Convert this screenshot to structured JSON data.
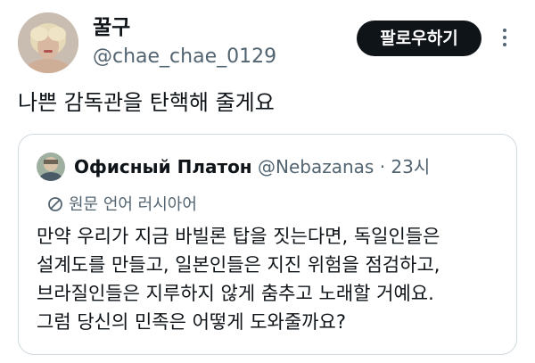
{
  "author": {
    "name": "꿀구",
    "handle": "@chae_chae_0129"
  },
  "follow_label": "팔로우하기",
  "tweet_text": "나쁜 감독관을 탄핵해 줄게요",
  "quote": {
    "name": "Офисный Платон",
    "handle": "@Nebazanas",
    "separator": "·",
    "time": "23시",
    "translate_label": "원문 언어 러시아어",
    "body_lines": [
      "만약 우리가 지금 바빌론 탑을 짓는다면, 독일인들은",
      "설계도를 만들고, 일본인들은 지진 위험을 점검하고,",
      "브라질인들은 지루하지 않게 춤추고 노래할 거예요.",
      "그럼 당신의 민족은 어떻게 도와줄까요?"
    ]
  },
  "icons": {
    "avatar": "avatar-photo",
    "more": "more-options-icon",
    "translate": "translate-icon"
  }
}
